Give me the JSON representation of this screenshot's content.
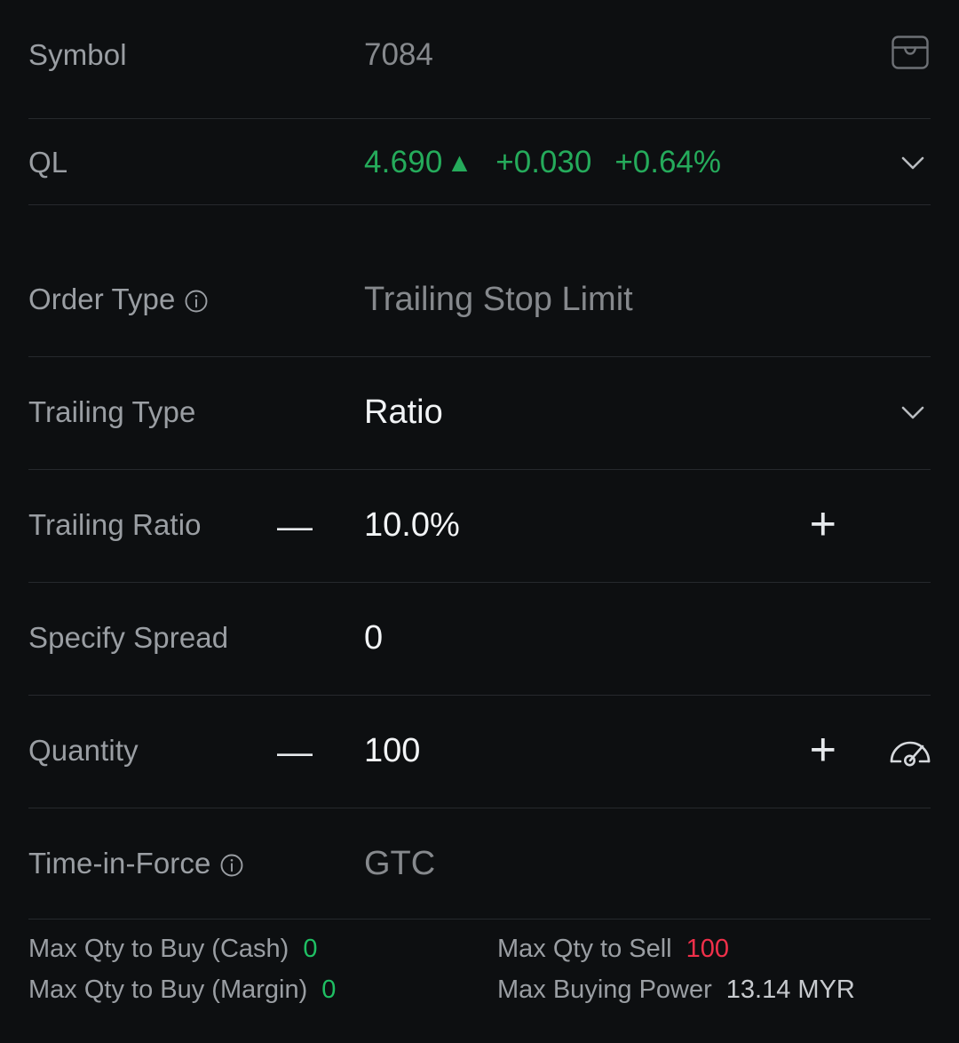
{
  "theme": {
    "background": "#0d0f11",
    "divider": "#26292d",
    "label_color": "#9a9ea3",
    "value_color": "#f2f4f6",
    "muted_value_color": "#86898d",
    "up_green": "#25ab5b",
    "down_red": "#f0304a"
  },
  "symbol_row": {
    "label": "Symbol",
    "value": "7084",
    "icon": "archive-box-icon"
  },
  "quote_row": {
    "label": "QL",
    "price": "4.690",
    "arrow": "▲",
    "change": "+0.030",
    "change_percent": "+0.64%",
    "direction": "up",
    "chevron": "chevron-down-icon"
  },
  "order_type_row": {
    "label": "Order Type",
    "info_icon": "info-icon",
    "value": "Trailing Stop Limit"
  },
  "trailing_type_row": {
    "label": "Trailing Type",
    "value": "Ratio",
    "chevron": "chevron-down-icon"
  },
  "trailing_ratio_row": {
    "label": "Trailing Ratio",
    "minus": "—",
    "value": "10.0%",
    "plus": "+"
  },
  "specify_spread_row": {
    "label": "Specify Spread",
    "value": "0"
  },
  "quantity_row": {
    "label": "Quantity",
    "minus": "—",
    "value": "100",
    "plus": "+",
    "gauge_icon": "gauge-icon"
  },
  "time_in_force_row": {
    "label": "Time-in-Force",
    "info_icon": "info-icon",
    "value": "GTC"
  },
  "footer": {
    "line1": {
      "left_label": "Max Qty to Buy (Cash)",
      "left_value": "0",
      "right_label": "Max Qty to Sell",
      "right_value": "100"
    },
    "line2": {
      "left_label": "Max Qty to Buy (Margin)",
      "left_value": "0",
      "right_label": "Max Buying Power",
      "right_value": "13.14 MYR"
    }
  }
}
